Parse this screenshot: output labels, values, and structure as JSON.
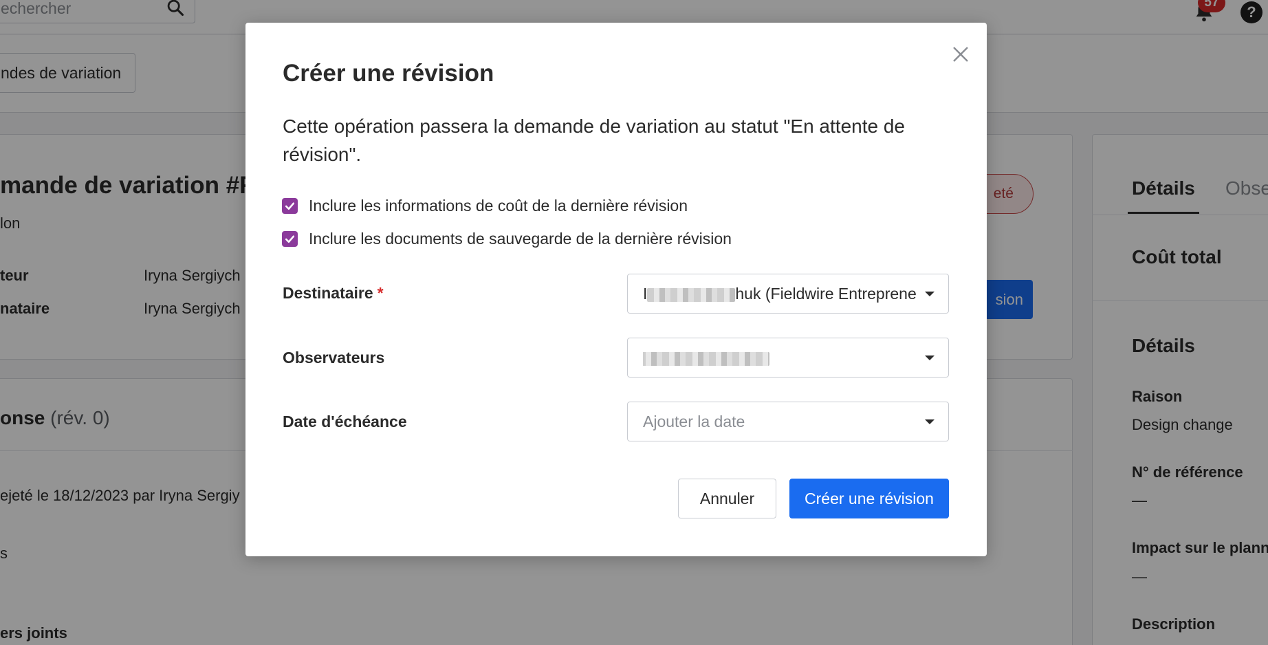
{
  "topbar": {
    "search_placeholder": "echercher",
    "notification_count": "57",
    "help_label": "?"
  },
  "subbar": {
    "crumb_button_label": "ndes de variation"
  },
  "page": {
    "title": "mande de variation #FE",
    "subtitle": "lon",
    "rows": [
      {
        "label": "teur",
        "value": "Iryna Sergiych"
      },
      {
        "label": "nataire",
        "value": "Iryna Sergiych"
      }
    ],
    "status_badge": "eté",
    "primary_button_fragment": "sion"
  },
  "response": {
    "title": "onse",
    "revision": "(rév. 0)",
    "rejected_line": "ejeté le 18/12/2023 par Iryna Sergiy",
    "fragment": "s",
    "attachments": "ers joints"
  },
  "right_panel": {
    "tabs": [
      "Détails",
      "Obse"
    ],
    "total_cost": "Coût total",
    "details_heading": "Détails",
    "fields": [
      {
        "label": "Raison",
        "value": "Design change"
      },
      {
        "label": "N° de référence",
        "value": "—"
      },
      {
        "label": "Impact sur le plann",
        "value": "—"
      },
      {
        "label": "Description",
        "value": ""
      }
    ]
  },
  "modal": {
    "title": "Créer une révision",
    "description": "Cette opération passera la demande de variation au statut \"En attente de révision\".",
    "checkboxes": [
      {
        "label": "Inclure les informations de coût de la dernière révision",
        "checked": true
      },
      {
        "label": "Inclure les documents de sauvegarde de la dernière révision",
        "checked": true
      }
    ],
    "fields": {
      "recipient": {
        "label": "Destinataire",
        "required_mark": "*",
        "value_prefix": "I",
        "value_suffix": "huk (Fieldwire Entreprene"
      },
      "observers": {
        "label": "Observateurs"
      },
      "due_date": {
        "label": "Date d'échéance",
        "placeholder": "Ajouter la date"
      }
    },
    "buttons": {
      "cancel": "Annuler",
      "create": "Créer une révision"
    }
  },
  "colors": {
    "primary": "#1a6cf0",
    "checkbox": "#8b3a9b",
    "required": "#d62a2a",
    "overlay": "rgba(0,0,0,0.42)"
  }
}
